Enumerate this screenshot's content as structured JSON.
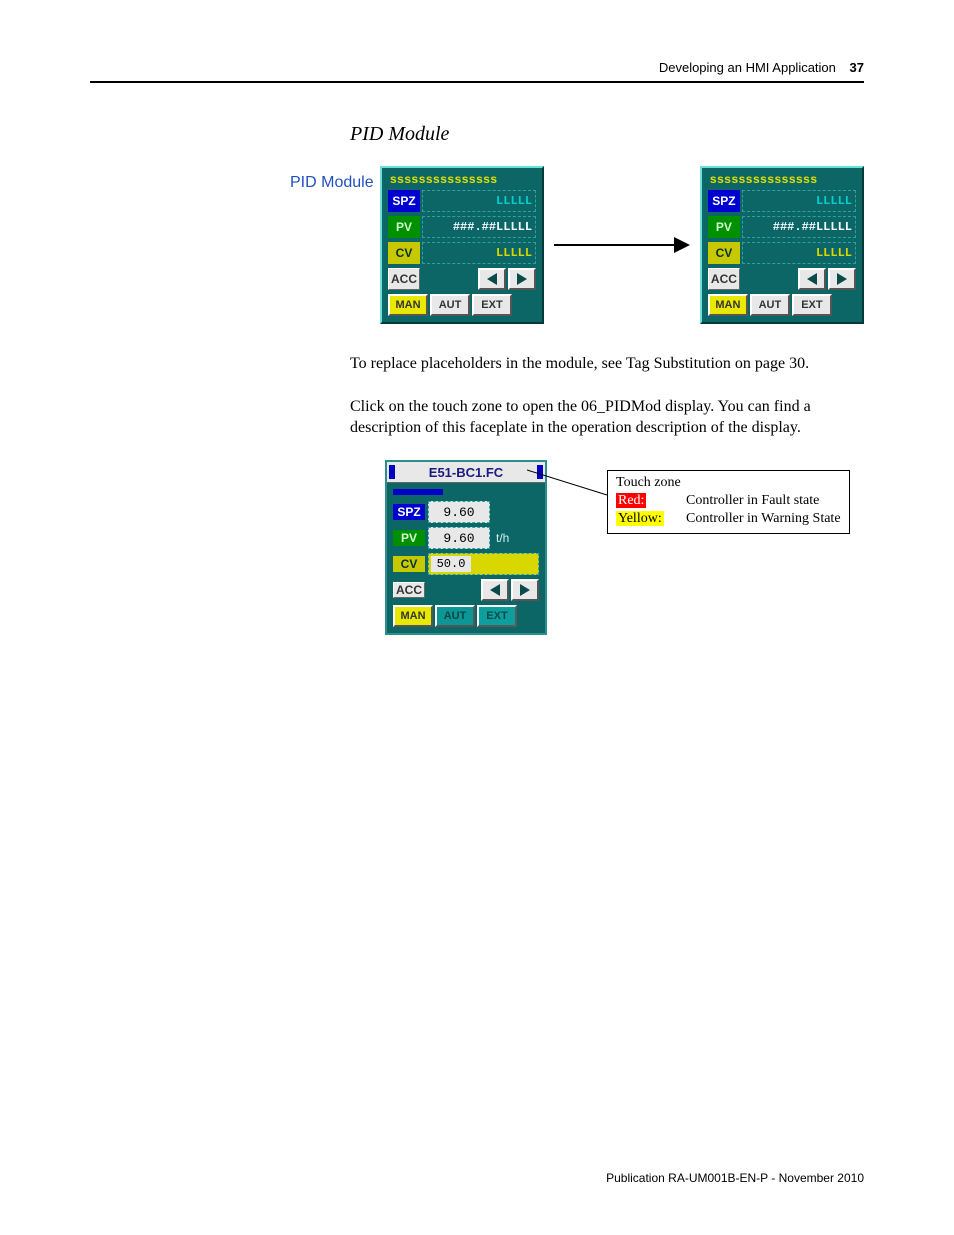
{
  "header": {
    "title": "Developing an HMI Application",
    "page": "37"
  },
  "section_heading": "PID Module",
  "row_label": "PID Module",
  "pid_placeholder": {
    "title": "sssssssssssssss",
    "spz_label": "SPZ",
    "spz_value": "LLLLL",
    "pv_label": "PV",
    "pv_value": "###.##LLLLL",
    "cv_label": "CV",
    "cv_value": "LLLLL",
    "acc_label": "ACC",
    "man_label": "MAN",
    "aut_label": "AUT",
    "ext_label": "EXT"
  },
  "para1": "To replace placeholders in the module, see Tag Substitution on page 30.",
  "para2": "Click on the touch zone to open the 06_PIDMod display. You can find a description of this faceplate in the operation description of the display.",
  "pid_face": {
    "title": "E51-BC1.FC",
    "spz_label": "SPZ",
    "spz_value": "9.60",
    "pv_label": "PV",
    "pv_value": "9.60",
    "pv_unit": "t/h",
    "cv_label": "CV",
    "cv_value": "50.0",
    "acc_label": "ACC",
    "man_label": "MAN",
    "aut_label": "AUT",
    "ext_label": "EXT"
  },
  "callout": {
    "title": "Touch zone",
    "red_label": "Red:",
    "red_text": "Controller in Fault state",
    "yellow_label": "Yellow:",
    "yellow_text": "Controller in Warning State"
  },
  "footer": "Publication RA-UM001B-EN-P - November 2010"
}
